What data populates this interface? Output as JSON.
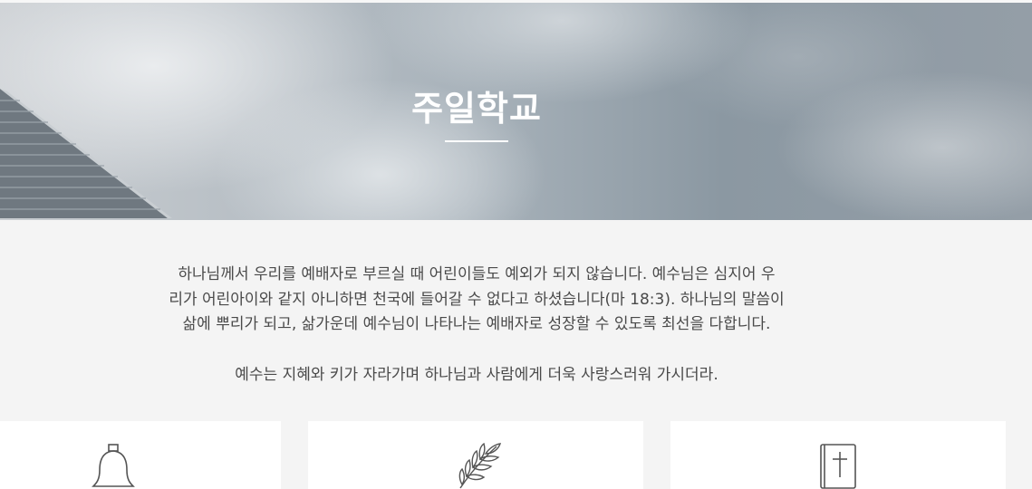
{
  "hero": {
    "title": "주일학교"
  },
  "intro": {
    "line1": "하나님께서 우리를 예배자로 부르실 때 어린이들도 예외가 되지 않습니다. 예수님은 심지어 우",
    "line2": "리가 어린아이와 같지 아니하면 천국에 들어갈 수 없다고 하셨습니다(마 18:3). 하나님의 말씀이",
    "line3": "삶에 뿌리가 되고, 삶가운데 예수님이 나타나는 예배자로 성장할 수 있도록 최선을 다합니다."
  },
  "verse": "예수는 지혜와 키가 자라가며 하나님과 사람에게 더욱 사랑스러워 가시더라.",
  "cards": [
    {
      "icon": "bell-icon"
    },
    {
      "icon": "olive-branch-icon"
    },
    {
      "icon": "bible-cross-icon"
    }
  ]
}
